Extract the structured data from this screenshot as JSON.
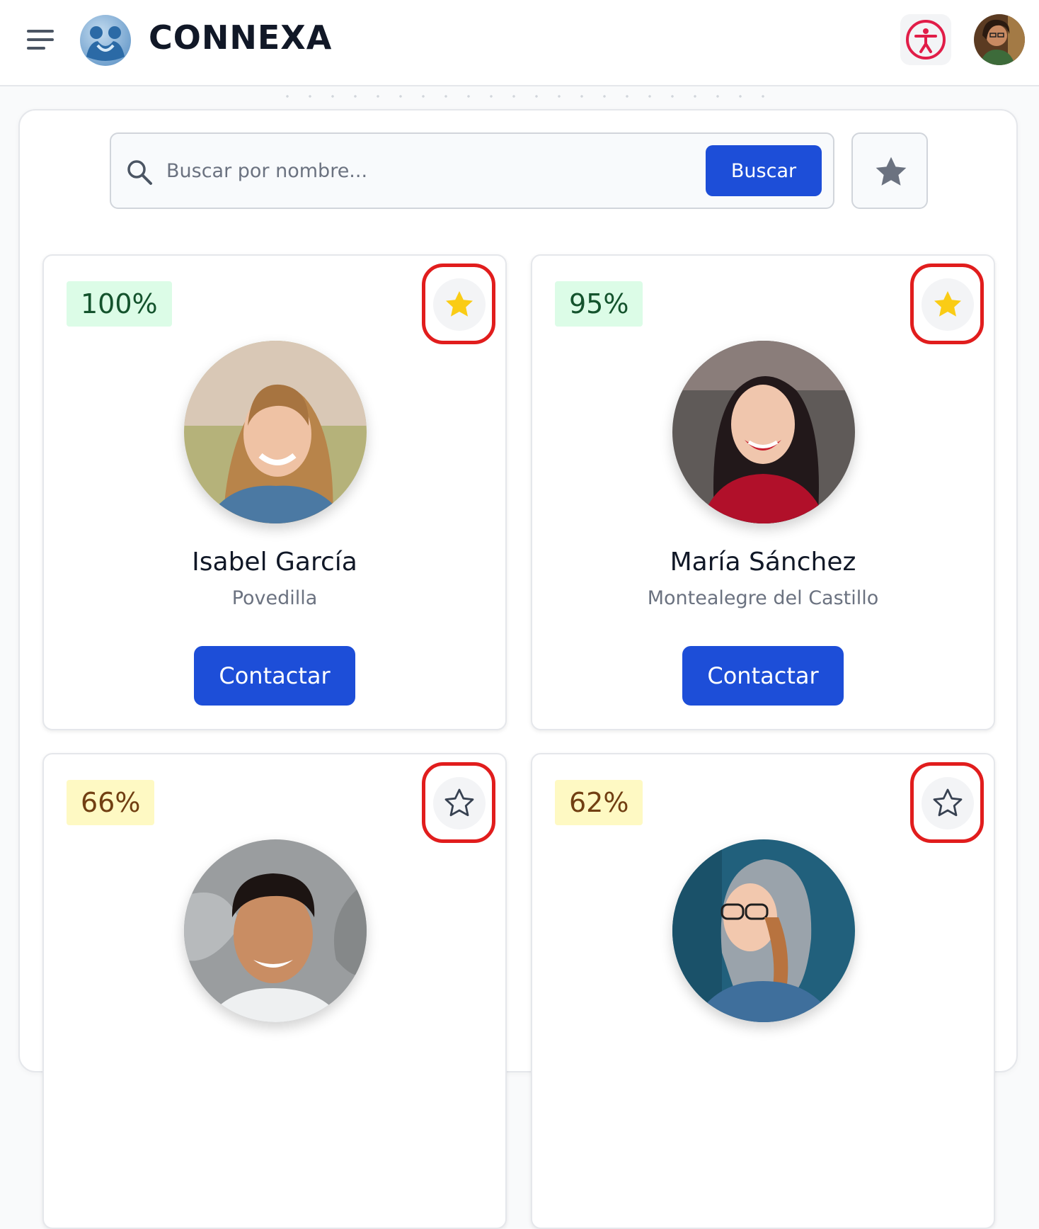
{
  "header": {
    "brand": "CONNEXA",
    "menu_icon": "hamburger-menu-icon",
    "logo_icon": "people-hug-logo-icon",
    "accessibility_icon": "accessibility-icon",
    "accent_color": "#e11d48"
  },
  "search": {
    "placeholder": "Buscar por nombre...",
    "button_label": "Buscar",
    "favorites_filter_icon": "star-icon"
  },
  "colors": {
    "primary": "#1d4ed8",
    "star_filled": "#facc15",
    "highlight": "#e11d1d",
    "badge_high_bg": "#dcfce7",
    "badge_mid_bg": "#fef9c3"
  },
  "cards": [
    {
      "match": "100%",
      "name": "Isabel García",
      "town": "Povedilla",
      "favorite": true,
      "contact_label": "Contactar"
    },
    {
      "match": "95%",
      "name": "María Sánchez",
      "town": "Montealegre del Castillo",
      "favorite": true,
      "contact_label": "Contactar"
    },
    {
      "match": "66%",
      "name": "",
      "town": "",
      "favorite": false,
      "contact_label": ""
    },
    {
      "match": "62%",
      "name": "",
      "town": "",
      "favorite": false,
      "contact_label": ""
    }
  ]
}
